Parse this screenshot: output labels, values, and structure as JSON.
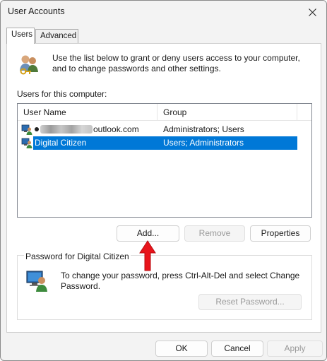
{
  "window": {
    "title": "User Accounts"
  },
  "tabs": [
    {
      "label": "Users",
      "active": true
    },
    {
      "label": "Advanced",
      "active": false
    }
  ],
  "intro": {
    "text": "Use the list below to grant or deny users access to your computer, and to change passwords and other settings."
  },
  "users_label": "Users for this computer:",
  "list": {
    "columns": [
      "User Name",
      "Group"
    ],
    "rows": [
      {
        "name_suffix": "outlook.com",
        "name_redacted": true,
        "group": "Administrators; Users",
        "selected": false
      },
      {
        "name": "Digital Citizen",
        "group": "Users; Administrators",
        "selected": true
      }
    ]
  },
  "buttons": {
    "add": "Add...",
    "remove": "Remove",
    "properties": "Properties",
    "reset_password": "Reset Password...",
    "ok": "OK",
    "cancel": "Cancel",
    "apply": "Apply"
  },
  "password_group": {
    "title": "Password for Digital Citizen",
    "text": "To change your password, press Ctrl-Alt-Del and select Change Password."
  },
  "colors": {
    "selection": "#0078d7",
    "annotation_arrow": "#e8141b"
  },
  "icons": {
    "close": "close-icon",
    "users": "users-keys-icon",
    "user_row": "user-computer-icon",
    "password": "user-computer-icon",
    "annotation": "red-up-arrow-icon"
  }
}
